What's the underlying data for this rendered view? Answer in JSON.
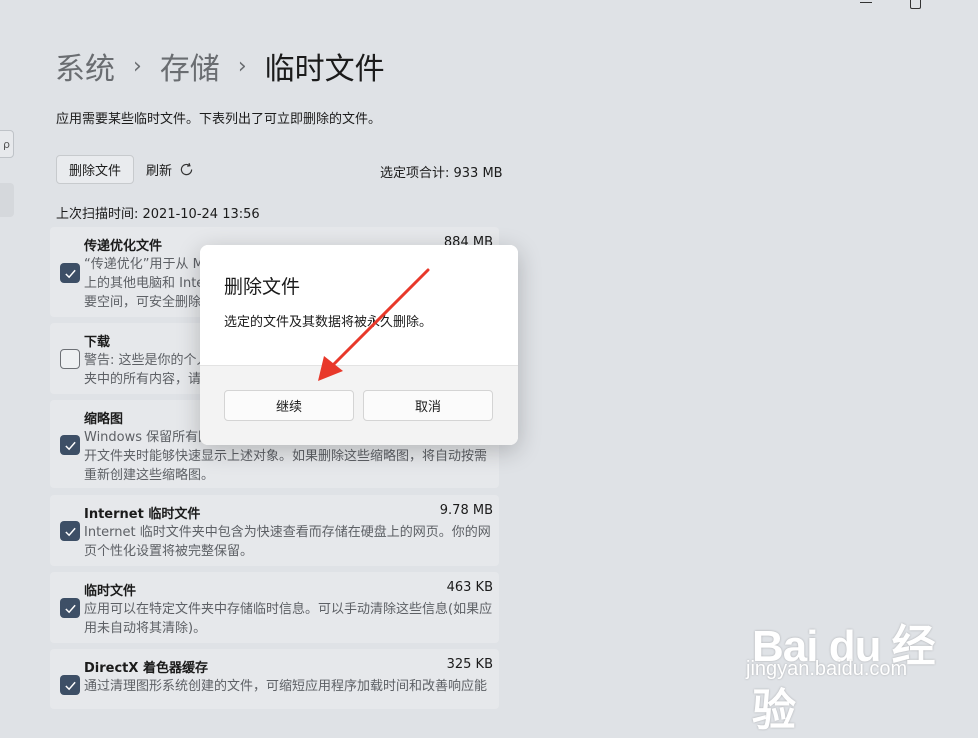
{
  "breadcrumb": {
    "items": [
      "系统",
      "存储"
    ],
    "current": "临时文件",
    "separator": "›"
  },
  "description": "应用需要某些临时文件。下表列出了可立即删除的文件。",
  "toolbar": {
    "delete_label": "删除文件",
    "refresh_label": "刷新",
    "total_label": "选定项合计: 933 MB"
  },
  "scan_time": "上次扫描时间: 2021-10-24 13:56",
  "items": [
    {
      "title": "传递优化文件",
      "size": "884 MB",
      "checked": true,
      "desc": "“传递优化”用于从 Microsoft 下载更新的文件中，以便上传到本地网络上的其他电脑和 Internet 上的电脑（具体取决于你的设置）。如果你需要空间，可安全删除这些文件。"
    },
    {
      "title": "下载",
      "size": "",
      "checked": false,
      "desc": "警告: 这些是你的个人“下载”文件夹中的文件。如果你想删除下载文件夹中的所有内容，请选择此项。此操作不会考虑回收站。"
    },
    {
      "title": "缩略图",
      "size": "",
      "checked": true,
      "desc": "Windows 保留所有图片、视频和文档文件的缩略图副本，以便在你打开文件夹时能够快速显示上述对象。如果删除这些缩略图，将自动按需重新创建这些缩略图。"
    },
    {
      "title": "Internet 临时文件",
      "size": "9.78 MB",
      "checked": true,
      "desc": "Internet 临时文件夹中包含为快速查看而存储在硬盘上的网页。你的网页个性化设置将被完整保留。"
    },
    {
      "title": "临时文件",
      "size": "463 KB",
      "checked": true,
      "desc": "应用可以在特定文件夹中存储临时信息。可以手动清除这些信息(如果应用未自动将其清除)。"
    },
    {
      "title": "DirectX 着色器缓存",
      "size": "325 KB",
      "checked": true,
      "desc": "通过清理图形系统创建的文件，可缩短应用程序加载时间和改善响应能力。"
    }
  ],
  "dialog": {
    "title": "删除文件",
    "message": "选定的文件及其数据将被永久删除。",
    "continue_label": "继续",
    "cancel_label": "取消"
  },
  "watermark": {
    "logo": "Bai du 经验",
    "url": "jingyan.baidu.com"
  },
  "colors": {
    "accent": "#3d4f66",
    "annotation_arrow": "#e8382a"
  }
}
